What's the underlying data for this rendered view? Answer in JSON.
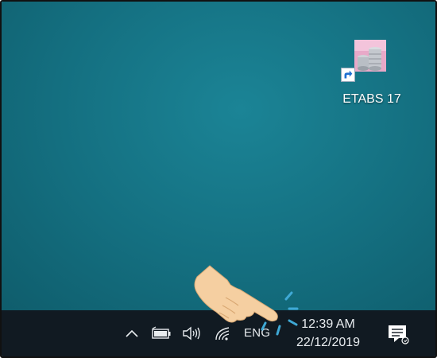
{
  "desktop": {
    "shortcuts": [
      {
        "label": "ETABS 17",
        "icon": "etabs-building-icon"
      }
    ]
  },
  "taskbar": {
    "tray_icons": [
      "chevron-up-icon",
      "battery-icon",
      "volume-icon",
      "wifi-icon"
    ],
    "language": "ENG",
    "time": "12:39 AM",
    "date": "22/12/2019",
    "notification_icon": "action-center-icon"
  },
  "overlay": {
    "pointer": "hand-pointer-icon",
    "target": "clock"
  },
  "colors": {
    "desktop_bg": "#146f80",
    "taskbar_bg": "#111a22",
    "click_marks": "#3fa9d6",
    "hand_skin": "#f5cfa1"
  }
}
